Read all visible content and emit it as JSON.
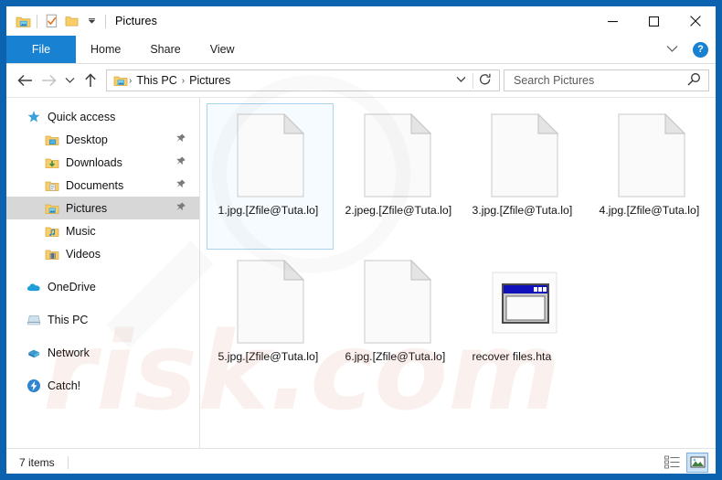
{
  "window": {
    "title": "Pictures",
    "border_color": "#0b63b0",
    "accent_color": "#1981d2",
    "minimize": "–",
    "maximize": "□",
    "close": "✕"
  },
  "quick_access_toolbar": {
    "items": [
      {
        "name": "pictures-folder-icon",
        "label": ""
      },
      {
        "name": "properties-icon",
        "label": ""
      },
      {
        "name": "new-folder-icon",
        "label": ""
      },
      {
        "name": "customize-dropdown-icon",
        "label": "▾"
      }
    ]
  },
  "ribbon": {
    "tabs": [
      {
        "label": "File",
        "active": true
      },
      {
        "label": "Home",
        "active": false
      },
      {
        "label": "Share",
        "active": false
      },
      {
        "label": "View",
        "active": false
      }
    ],
    "expand_chevron": "⌄",
    "help_label": "?"
  },
  "addressbar": {
    "back": "←",
    "forward": "→",
    "recent_chevron": "⌄",
    "up": "↑",
    "crumbs": [
      "This PC",
      "Pictures"
    ],
    "crumb_separator": "›",
    "history_chevron": "⌄",
    "refresh": "↻"
  },
  "search": {
    "placeholder": "Search Pictures",
    "value": "",
    "icon": "search-icon"
  },
  "sidebar": {
    "items": [
      {
        "label": "Quick access",
        "icon": "star-icon",
        "indent": false,
        "pinned": false,
        "selected": false,
        "spaced": false
      },
      {
        "label": "Desktop",
        "icon": "desktop-folder-icon",
        "indent": true,
        "pinned": true,
        "selected": false,
        "spaced": false
      },
      {
        "label": "Downloads",
        "icon": "downloads-folder-icon",
        "indent": true,
        "pinned": true,
        "selected": false,
        "spaced": false
      },
      {
        "label": "Documents",
        "icon": "documents-folder-icon",
        "indent": true,
        "pinned": true,
        "selected": false,
        "spaced": false
      },
      {
        "label": "Pictures",
        "icon": "pictures-folder-icon",
        "indent": true,
        "pinned": true,
        "selected": true,
        "spaced": false
      },
      {
        "label": "Music",
        "icon": "music-folder-icon",
        "indent": true,
        "pinned": false,
        "selected": false,
        "spaced": false
      },
      {
        "label": "Videos",
        "icon": "videos-folder-icon",
        "indent": true,
        "pinned": false,
        "selected": false,
        "spaced": false
      },
      {
        "label": "OneDrive",
        "icon": "onedrive-cloud-icon",
        "indent": false,
        "pinned": false,
        "selected": false,
        "spaced": true
      },
      {
        "label": "This PC",
        "icon": "this-pc-icon",
        "indent": false,
        "pinned": false,
        "selected": false,
        "spaced": true
      },
      {
        "label": "Network",
        "icon": "network-icon",
        "indent": false,
        "pinned": false,
        "selected": false,
        "spaced": true
      },
      {
        "label": "Catch!",
        "icon": "catch-icon",
        "indent": false,
        "pinned": false,
        "selected": false,
        "spaced": true
      }
    ]
  },
  "files": [
    {
      "name": "1.jpg.[Zfile@Tuta.lo]",
      "icon": "blank-document-icon",
      "selected": true
    },
    {
      "name": "2.jpeg.[Zfile@Tuta.lo]",
      "icon": "blank-document-icon",
      "selected": false
    },
    {
      "name": "3.jpg.[Zfile@Tuta.lo]",
      "icon": "blank-document-icon",
      "selected": false
    },
    {
      "name": "4.jpg.[Zfile@Tuta.lo]",
      "icon": "blank-document-icon",
      "selected": false
    },
    {
      "name": "5.jpg.[Zfile@Tuta.lo]",
      "icon": "blank-document-icon",
      "selected": false
    },
    {
      "name": "6.jpg.[Zfile@Tuta.lo]",
      "icon": "blank-document-icon",
      "selected": false
    },
    {
      "name": "recover files.hta",
      "icon": "hta-window-icon",
      "selected": false
    }
  ],
  "statusbar": {
    "item_count": "7 items",
    "views": [
      {
        "name": "details-view-button",
        "active": false
      },
      {
        "name": "large-icons-view-button",
        "active": true
      }
    ]
  },
  "watermark": {
    "text": "risk.com"
  }
}
